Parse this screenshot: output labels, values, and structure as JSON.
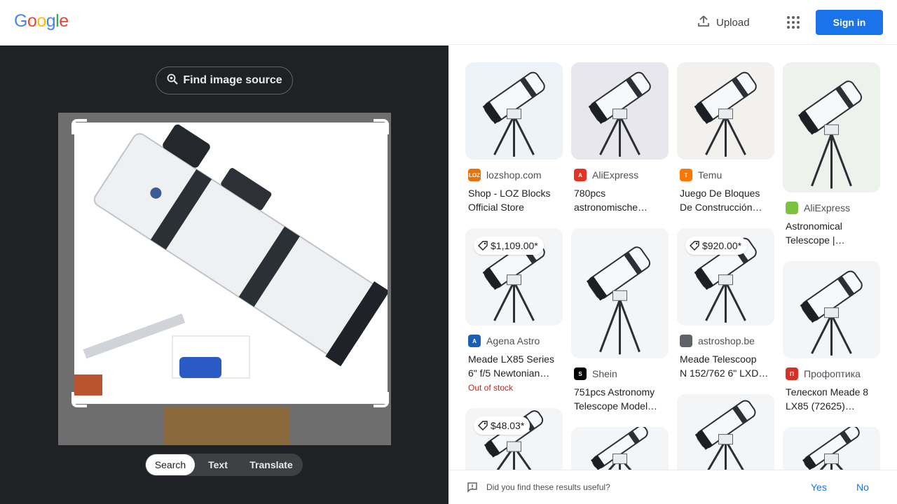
{
  "header": {
    "logo_letters": [
      {
        "ch": "G",
        "color": "#4285f4"
      },
      {
        "ch": "o",
        "color": "#ea4335"
      },
      {
        "ch": "o",
        "color": "#fbbc05"
      },
      {
        "ch": "g",
        "color": "#4285f4"
      },
      {
        "ch": "l",
        "color": "#34a853"
      },
      {
        "ch": "e",
        "color": "#ea4335"
      }
    ],
    "upload_label": "Upload",
    "apps_icon": "apps-grid-icon",
    "signin_label": "Sign in",
    "accent": "#1a73e8"
  },
  "lens": {
    "find_source_label": "Find image source",
    "modes": [
      "Search",
      "Text",
      "Translate"
    ],
    "active_mode": "Search"
  },
  "results": {
    "columns": [
      [
        {
          "source": "lozshop.com",
          "favicon_text": "LOZ",
          "favicon_color": "#e8710a",
          "title_lines": [
            "Shop - LOZ Blocks",
            "Official Store"
          ],
          "price": "",
          "stock": ""
        },
        {
          "source": "Agena Astro",
          "favicon_text": "A",
          "favicon_color": "#1a5fb4",
          "title_lines": [
            "Meade LX85 Series",
            "6\" f/5 Newtonian…"
          ],
          "price": "$1,109.00*",
          "stock": "Out of stock"
        },
        {
          "source": "",
          "favicon_text": "",
          "favicon_color": "",
          "title_lines": [],
          "price": "$48.03*",
          "stock": ""
        }
      ],
      [
        {
          "source": "AliExpress",
          "favicon_text": "A",
          "favicon_color": "#e43225",
          "title_lines": [
            "780pcs",
            "astronomische…"
          ],
          "price": "",
          "stock": ""
        },
        {
          "source": "Shein",
          "favicon_text": "S",
          "favicon_color": "#000000",
          "title_lines": [
            "751pcs Astronomy",
            "Telescope Model…"
          ],
          "price": "",
          "stock": ""
        },
        {
          "source": "",
          "favicon_text": "",
          "favicon_color": "",
          "title_lines": [],
          "price": "",
          "stock": ""
        }
      ],
      [
        {
          "source": "Temu",
          "favicon_text": "T",
          "favicon_color": "#fb7701",
          "title_lines": [
            "Juego De Bloques",
            "De Construcción…"
          ],
          "price": "",
          "stock": ""
        },
        {
          "source": "astroshop.be",
          "favicon_text": "",
          "favicon_color": "#5f6368",
          "title_lines": [
            "Meade Telescoop",
            "N 152/762 6\" LXD7…"
          ],
          "price": "$920.00*",
          "stock": ""
        },
        {
          "source": "",
          "favicon_text": "",
          "favicon_color": "",
          "title_lines": [],
          "price": "",
          "stock": ""
        }
      ],
      [
        {
          "source": "AliExpress",
          "favicon_text": "",
          "favicon_color": "#7cc242",
          "title_lines": [
            "Astronomical",
            "Telescope |…"
          ],
          "price": "",
          "stock": ""
        },
        {
          "source": "Профоптика",
          "favicon_text": "П",
          "favicon_color": "#d93025",
          "title_lines": [
            "Телескоп Meade 8",
            "LX85 (72625)…"
          ],
          "price": "",
          "stock": ""
        },
        {
          "source": "",
          "favicon_text": "",
          "favicon_color": "",
          "title_lines": [],
          "price": "",
          "stock": ""
        }
      ]
    ]
  },
  "feedback": {
    "question": "Did you find these results useful?",
    "yes_label": "Yes",
    "no_label": "No"
  }
}
